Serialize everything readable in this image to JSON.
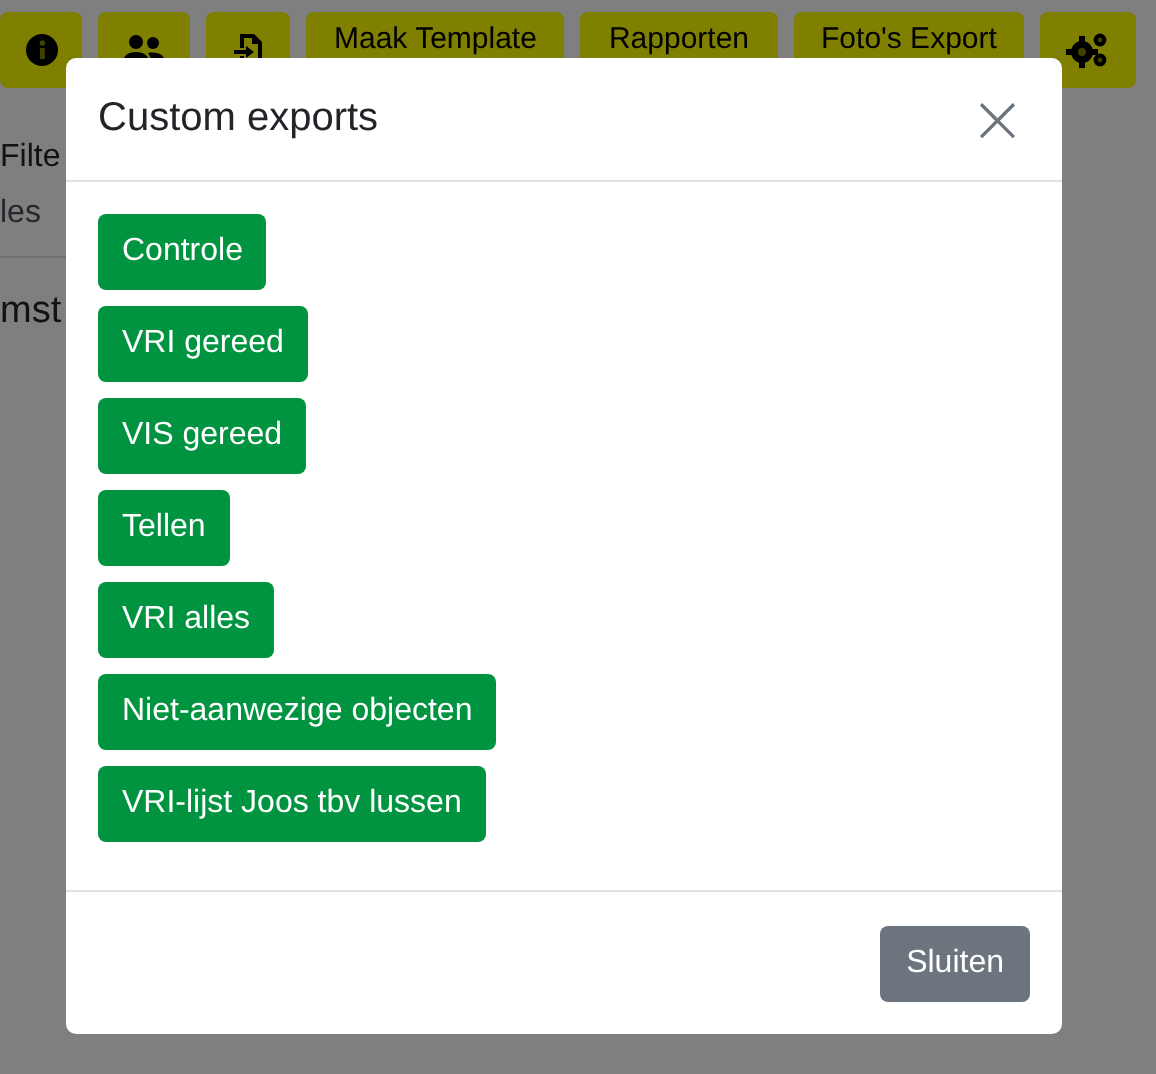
{
  "toolbar": [
    {
      "kind": "icon"
    },
    {
      "kind": "icon"
    },
    {
      "kind": "icon"
    },
    {
      "kind": "text",
      "label": "Maak Template"
    },
    {
      "kind": "text",
      "label": "Rapporten"
    },
    {
      "kind": "text",
      "label": "Foto's Export"
    },
    {
      "kind": "icon"
    }
  ],
  "background": {
    "filter_label": "Filte",
    "tab_label": "les",
    "heading": "mst"
  },
  "modal": {
    "title": "Custom exports",
    "close": "×",
    "exports": [
      "Controle",
      "VRI gereed",
      "VIS gereed",
      "Tellen",
      "VRI alles",
      "Niet-aanwezige objecten",
      "VRI-lijst Joos tbv lussen"
    ],
    "footer_button": "Sluiten"
  }
}
